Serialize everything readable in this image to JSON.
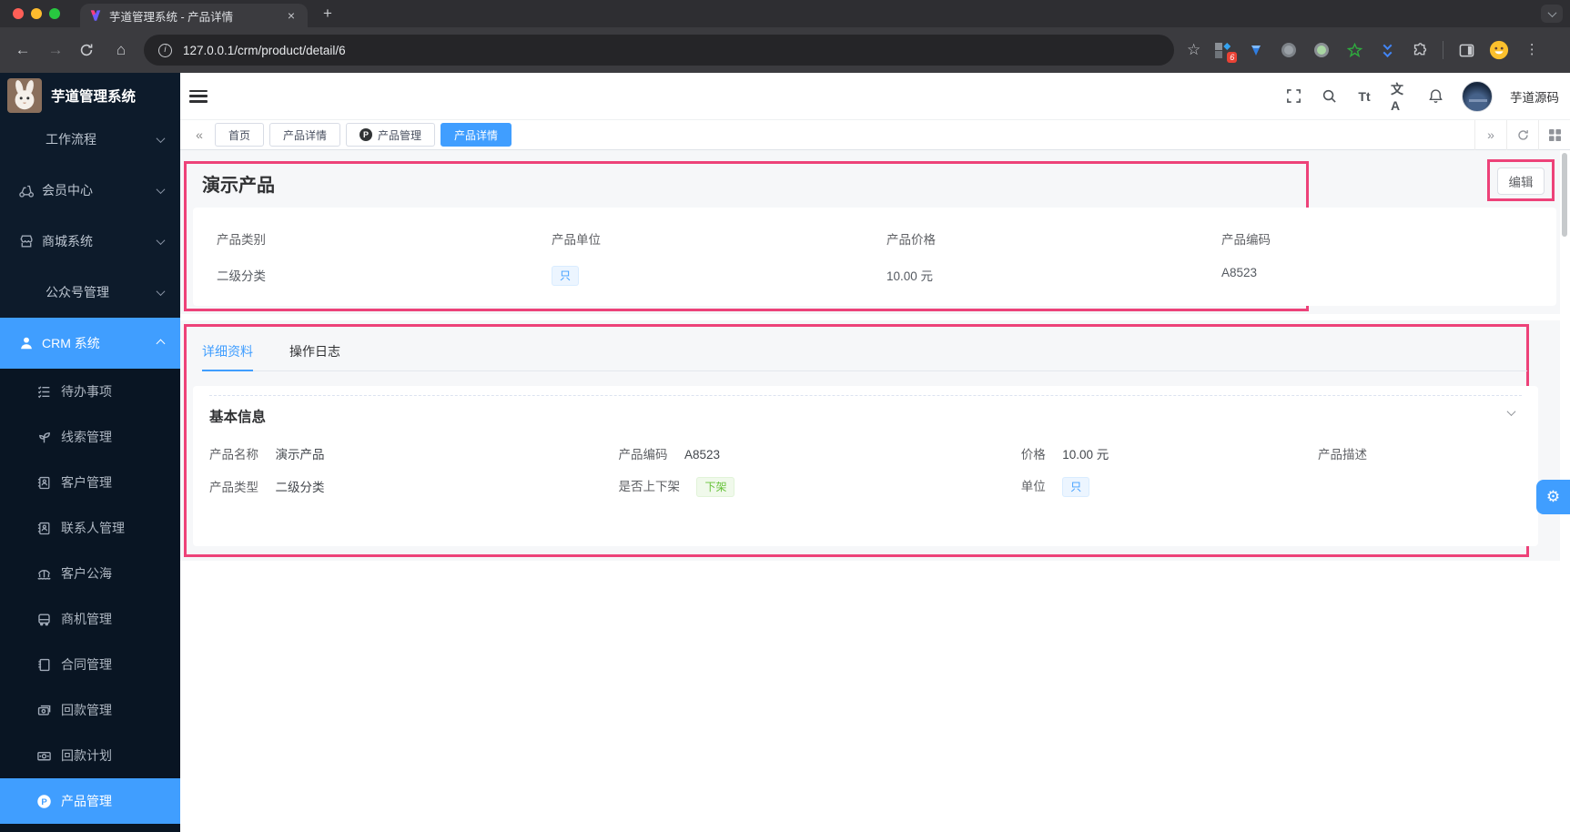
{
  "browser": {
    "tab_title": "芋道管理系统 - 产品详情",
    "url": "127.0.0.1/crm/product/detail/6",
    "ext_badge": "6"
  },
  "icons": {
    "close": "×",
    "new_tab": "+",
    "back": "←",
    "forward": "→",
    "home": "⌂",
    "star": "☆",
    "kebab": "⋮",
    "info": "i",
    "chevrons_left": "«",
    "chevrons_right": "»",
    "gear": "⚙",
    "font_size": "Tt",
    "language": "文A",
    "product_letter": "P"
  },
  "app": {
    "brand": "芋道管理系统",
    "user_name": "芋道源码"
  },
  "sidebar": {
    "items": [
      {
        "label": "工作流程"
      },
      {
        "label": "会员中心"
      },
      {
        "label": "商城系统"
      },
      {
        "label": "公众号管理"
      },
      {
        "label": "CRM 系统"
      }
    ],
    "submenu": [
      {
        "label": "待办事项"
      },
      {
        "label": "线索管理"
      },
      {
        "label": "客户管理"
      },
      {
        "label": "联系人管理"
      },
      {
        "label": "客户公海"
      },
      {
        "label": "商机管理"
      },
      {
        "label": "合同管理"
      },
      {
        "label": "回款管理"
      },
      {
        "label": "回款计划"
      },
      {
        "label": "产品管理"
      }
    ]
  },
  "tags_view": {
    "tabs": [
      {
        "label": "首页"
      },
      {
        "label": "产品详情"
      },
      {
        "label": "产品管理"
      },
      {
        "label": "产品详情"
      }
    ]
  },
  "product_header": {
    "title": "演示产品",
    "edit_button": "编辑",
    "fields": [
      {
        "label": "产品类别",
        "value": "二级分类"
      },
      {
        "label": "产品单位",
        "value": "只"
      },
      {
        "label": "产品价格",
        "value": "10.00 元"
      },
      {
        "label": "产品编码",
        "value": "A8523"
      }
    ]
  },
  "detail": {
    "tabs": [
      {
        "label": "详细资料"
      },
      {
        "label": "操作日志"
      }
    ],
    "section_title": "基本信息",
    "fields": [
      {
        "label": "产品名称",
        "value": "演示产品"
      },
      {
        "label": "产品编码",
        "value": "A8523"
      },
      {
        "label": "价格",
        "value": "10.00 元"
      },
      {
        "label": "产品描述",
        "value": ""
      },
      {
        "label": "产品类型",
        "value": "二级分类"
      },
      {
        "label": "是否上下架",
        "value": "下架"
      },
      {
        "label": "单位",
        "value": "只"
      }
    ]
  },
  "colors": {
    "accent": "#409eff",
    "highlight_pink": "#ed4279",
    "sidebar_bg": "#0d1b2b",
    "tag_blue_bg": "#ecf5ff",
    "tag_blue_text": "#409eff",
    "tag_green_bg": "#f0f9eb",
    "tag_green_text": "#67c23a"
  }
}
